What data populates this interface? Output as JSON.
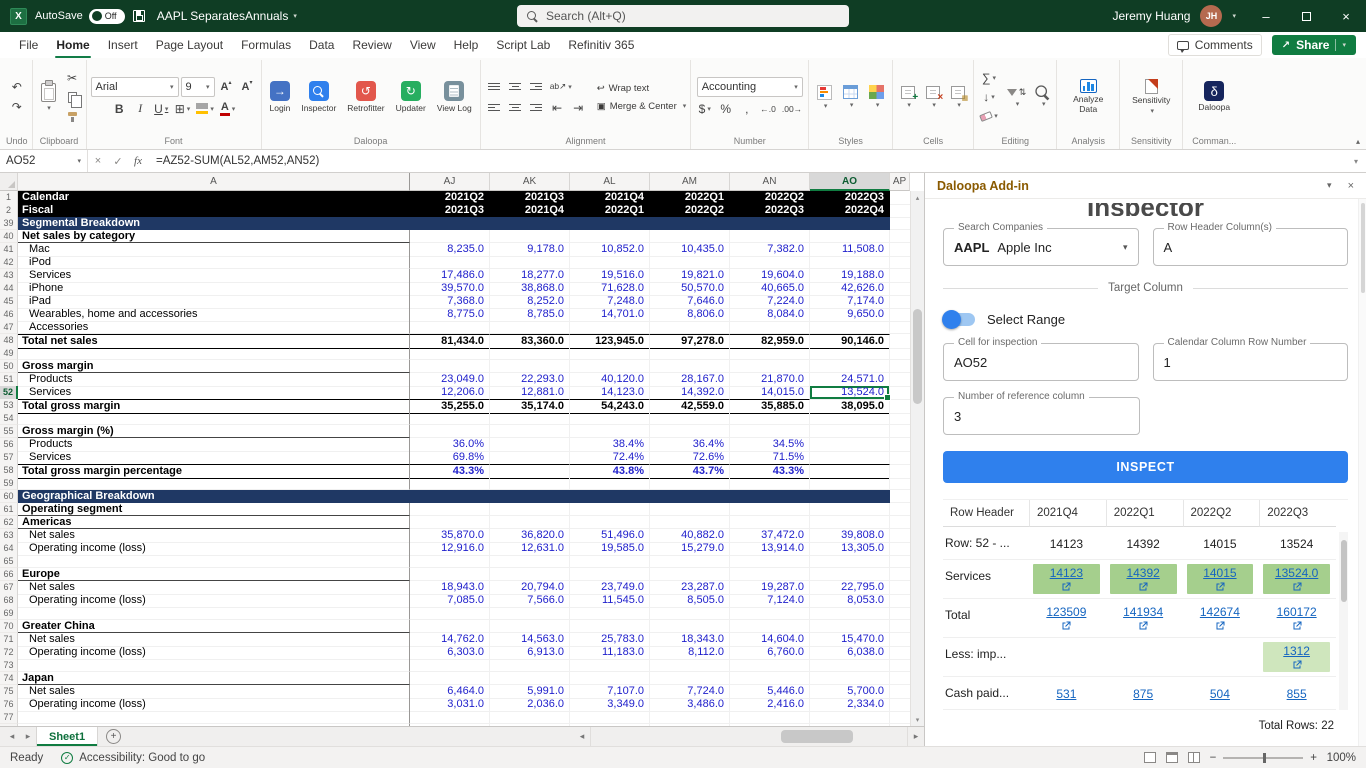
{
  "titlebar": {
    "autosave_label": "AutoSave",
    "autosave_state": "Off",
    "title": "AAPL SeparatesAnnuals",
    "search_placeholder": "Search (Alt+Q)",
    "user_name": "Jeremy Huang",
    "user_initials": "JH"
  },
  "menubar": {
    "tabs": [
      "File",
      "Home",
      "Insert",
      "Page Layout",
      "Formulas",
      "Data",
      "Review",
      "View",
      "Help",
      "Script Lab",
      "Refinitiv 365"
    ],
    "active_tab": "Home",
    "comments_label": "Comments",
    "share_label": "Share"
  },
  "ribbon": {
    "font_name": "Arial",
    "font_size": "9",
    "number_format": "Accounting",
    "wrap_text": "Wrap text",
    "merge_center": "Merge & Center",
    "daloopa_buttons": [
      "Login",
      "Inspector",
      "Retrofitter",
      "Updater",
      "View Log"
    ],
    "analyze_label": "Analyze Data",
    "sensitivity_label": "Sensitivity",
    "daloopa_label": "Daloopa",
    "group_labels": [
      "Undo",
      "Clipboard",
      "Font",
      "Daloopa",
      "Alignment",
      "Number",
      "Styles",
      "Cells",
      "Editing",
      "Analysis",
      "Sensitivity",
      "Comman..."
    ]
  },
  "formula_bar": {
    "name_box": "AO52",
    "formula": "=AZ52-SUM(AL52,AM52,AN52)"
  },
  "sheet": {
    "col_headers": [
      "A",
      "AJ",
      "AK",
      "AL",
      "AM",
      "AN",
      "AO",
      "AP"
    ],
    "selected_col": "AO",
    "selected_row": 52,
    "selected_cell": "AO52",
    "tab_name": "Sheet1",
    "rows": [
      {
        "n": 1,
        "style": "hdr",
        "label": "Calendar",
        "values": [
          "2021Q2",
          "2021Q3",
          "2021Q4",
          "2022Q1",
          "2022Q2",
          "2022Q3"
        ]
      },
      {
        "n": 2,
        "style": "hdr",
        "label": "Fiscal",
        "values": [
          "2021Q3",
          "2021Q4",
          "2022Q1",
          "2022Q2",
          "2022Q3",
          "2022Q4"
        ]
      },
      {
        "n": 39,
        "style": "section",
        "label": "Segmental Breakdown"
      },
      {
        "n": 40,
        "style": "subhead",
        "label": "Net sales by category"
      },
      {
        "n": 41,
        "style": "data",
        "indent": 1,
        "label": "Mac",
        "values": [
          "8,235.0",
          "9,178.0",
          "10,852.0",
          "10,435.0",
          "7,382.0",
          "11,508.0"
        ]
      },
      {
        "n": 42,
        "style": "data",
        "indent": 1,
        "label": "iPod"
      },
      {
        "n": 43,
        "style": "data",
        "indent": 1,
        "label": "Services",
        "values": [
          "17,486.0",
          "18,277.0",
          "19,516.0",
          "19,821.0",
          "19,604.0",
          "19,188.0"
        ]
      },
      {
        "n": 44,
        "style": "data",
        "indent": 1,
        "label": "iPhone",
        "values": [
          "39,570.0",
          "38,868.0",
          "71,628.0",
          "50,570.0",
          "40,665.0",
          "42,626.0"
        ]
      },
      {
        "n": 45,
        "style": "data",
        "indent": 1,
        "label": "iPad",
        "values": [
          "7,368.0",
          "8,252.0",
          "7,248.0",
          "7,646.0",
          "7,224.0",
          "7,174.0"
        ]
      },
      {
        "n": 46,
        "style": "data",
        "indent": 1,
        "label": "Wearables, home and accessories",
        "values": [
          "8,775.0",
          "8,785.0",
          "14,701.0",
          "8,806.0",
          "8,084.0",
          "9,650.0"
        ]
      },
      {
        "n": 47,
        "style": "data",
        "indent": 1,
        "label": "Accessories"
      },
      {
        "n": 48,
        "style": "total",
        "label": "Total net sales",
        "values": [
          "81,434.0",
          "83,360.0",
          "123,945.0",
          "97,278.0",
          "82,959.0",
          "90,146.0"
        ]
      },
      {
        "n": 49,
        "style": "blank"
      },
      {
        "n": 50,
        "style": "subhead",
        "label": "Gross margin"
      },
      {
        "n": 51,
        "style": "data",
        "indent": 1,
        "label": "Products",
        "values": [
          "23,049.0",
          "22,293.0",
          "40,120.0",
          "28,167.0",
          "21,870.0",
          "24,571.0"
        ]
      },
      {
        "n": 52,
        "style": "data",
        "indent": 1,
        "label": "Services",
        "values": [
          "12,206.0",
          "12,881.0",
          "14,123.0",
          "14,392.0",
          "14,015.0",
          "13,524.0"
        ]
      },
      {
        "n": 53,
        "style": "total",
        "label": "Total gross margin",
        "values": [
          "35,255.0",
          "35,174.0",
          "54,243.0",
          "42,559.0",
          "35,885.0",
          "38,095.0"
        ]
      },
      {
        "n": 54,
        "style": "blank"
      },
      {
        "n": 55,
        "style": "subhead",
        "label": "Gross margin (%)"
      },
      {
        "n": 56,
        "style": "pct",
        "indent": 1,
        "label": "Products",
        "values": [
          "36.0%",
          "",
          "38.4%",
          "36.4%",
          "34.5%",
          ""
        ]
      },
      {
        "n": 57,
        "style": "pct",
        "indent": 1,
        "label": "Services",
        "values": [
          "69.8%",
          "",
          "72.4%",
          "72.6%",
          "71.5%",
          ""
        ]
      },
      {
        "n": 58,
        "style": "pcttotal",
        "label": "Total gross margin percentage",
        "values": [
          "43.3%",
          "",
          "43.8%",
          "43.7%",
          "43.3%",
          ""
        ]
      },
      {
        "n": 59,
        "style": "blank"
      },
      {
        "n": 60,
        "style": "section",
        "label": "Geographical Breakdown"
      },
      {
        "n": 61,
        "style": "subhead",
        "label": "Operating segment"
      },
      {
        "n": 62,
        "style": "region",
        "label": "Americas"
      },
      {
        "n": 63,
        "style": "data",
        "indent": 1,
        "label": "Net sales",
        "values": [
          "35,870.0",
          "36,820.0",
          "51,496.0",
          "40,882.0",
          "37,472.0",
          "39,808.0"
        ]
      },
      {
        "n": 64,
        "style": "data",
        "indent": 1,
        "label": "Operating income (loss)",
        "values": [
          "12,916.0",
          "12,631.0",
          "19,585.0",
          "15,279.0",
          "13,914.0",
          "13,305.0"
        ]
      },
      {
        "n": 65,
        "style": "blank"
      },
      {
        "n": 66,
        "style": "region",
        "label": "Europe"
      },
      {
        "n": 67,
        "style": "data",
        "indent": 1,
        "label": "Net sales",
        "values": [
          "18,943.0",
          "20,794.0",
          "23,749.0",
          "23,287.0",
          "19,287.0",
          "22,795.0"
        ]
      },
      {
        "n": 68,
        "style": "data",
        "indent": 1,
        "label": "Operating income (loss)",
        "values": [
          "7,085.0",
          "7,566.0",
          "11,545.0",
          "8,505.0",
          "7,124.0",
          "8,053.0"
        ]
      },
      {
        "n": 69,
        "style": "blank"
      },
      {
        "n": 70,
        "style": "region",
        "label": "Greater China"
      },
      {
        "n": 71,
        "style": "data",
        "indent": 1,
        "label": "Net sales",
        "values": [
          "14,762.0",
          "14,563.0",
          "25,783.0",
          "18,343.0",
          "14,604.0",
          "15,470.0"
        ]
      },
      {
        "n": 72,
        "style": "data",
        "indent": 1,
        "label": "Operating income (loss)",
        "values": [
          "6,303.0",
          "6,913.0",
          "11,183.0",
          "8,112.0",
          "6,760.0",
          "6,038.0"
        ]
      },
      {
        "n": 73,
        "style": "blank"
      },
      {
        "n": 74,
        "style": "region",
        "label": "Japan"
      },
      {
        "n": 75,
        "style": "data",
        "indent": 1,
        "label": "Net sales",
        "values": [
          "6,464.0",
          "5,991.0",
          "7,107.0",
          "7,724.0",
          "5,446.0",
          "5,700.0"
        ]
      },
      {
        "n": 76,
        "style": "data",
        "indent": 1,
        "label": "Operating income (loss)",
        "values": [
          "3,031.0",
          "2,036.0",
          "3,349.0",
          "3,486.0",
          "2,416.0",
          "2,334.0"
        ]
      },
      {
        "n": 77,
        "style": "blank"
      },
      {
        "n": 78,
        "style": "blank"
      }
    ]
  },
  "statusbar": {
    "mode": "Ready",
    "accessibility": "Accessibility: Good to go",
    "zoom": "100%"
  },
  "addin": {
    "header": "Daloopa Add-in",
    "title": "Inspector",
    "search_companies_label": "Search Companies",
    "ticker": "AAPL",
    "company": "Apple Inc",
    "row_header_label": "Row Header Column(s)",
    "row_header_value": "A",
    "target_column_label": "Target Column",
    "select_range_label": "Select Range",
    "cell_label": "Cell for inspection",
    "cell_value": "AO52",
    "calendar_label": "Calendar Column Row Number",
    "calendar_value": "1",
    "ref_label": "Number of reference column",
    "ref_value": "3",
    "inspect_label": "INSPECT",
    "table": {
      "headers": [
        "Row Header",
        "2021Q4",
        "2022Q1",
        "2022Q2",
        "2022Q3"
      ],
      "rows": [
        {
          "label": "Row: 52 - ...",
          "cells": [
            {
              "t": "14123"
            },
            {
              "t": "14392"
            },
            {
              "t": "14015"
            },
            {
              "t": "13524"
            }
          ]
        },
        {
          "label": "Services",
          "cells": [
            {
              "t": "14123",
              "bg": "green",
              "link": true,
              "icon": true
            },
            {
              "t": "14392",
              "bg": "green",
              "link": true,
              "icon": true
            },
            {
              "t": "14015",
              "bg": "green",
              "link": true,
              "icon": true
            },
            {
              "t": "13524.0",
              "bg": "green",
              "link": true,
              "icon": true
            }
          ]
        },
        {
          "label": "Total",
          "cells": [
            {
              "t": "123509",
              "link": true,
              "icon": true
            },
            {
              "t": "141934",
              "link": true,
              "icon": true
            },
            {
              "t": "142674",
              "link": true,
              "icon": true
            },
            {
              "t": "160172",
              "link": true,
              "icon": true
            }
          ]
        },
        {
          "label": "Less: imp...",
          "cells": [
            {},
            {},
            {},
            {
              "t": "1312",
              "bg": "lightgreen",
              "link": true,
              "icon": true
            }
          ]
        },
        {
          "label": "Cash paid...",
          "cells": [
            {
              "t": "531",
              "link": true
            },
            {
              "t": "875",
              "link": true
            },
            {
              "t": "504",
              "link": true
            },
            {
              "t": "855",
              "link": true
            }
          ]
        }
      ],
      "total_rows": "Total Rows: 22"
    }
  },
  "icons": {
    "app": "X",
    "undo": "↶",
    "redo": "↷",
    "cut": "✂",
    "dropdown": "▾",
    "bold": "B",
    "italic": "I",
    "underline": "U",
    "borders": "⊞",
    "letter_A": "A",
    "grow_caret": "▴",
    "shrink_caret": "▾",
    "wrap": "↩",
    "merge": "▣",
    "orient": "ab↗",
    "indent_left": "⇤",
    "indent_right": "⇥",
    "currency": "$",
    "percent": "%",
    "comma": ",",
    "increase_decimal": "←.0",
    "decrease_decimal": ".00→",
    "autosum": "∑",
    "fill_down": "↓",
    "sort_az": "⇅",
    "daloopa_delta": "δ",
    "login_arrow": "→",
    "retrofit_arrow": "↺",
    "update_arrow": "↻",
    "cancel": "×",
    "check": "✓",
    "fx": "fx",
    "min": "–",
    "close": "×",
    "nav_left": "◂",
    "nav_right": "▸",
    "collapse": "▴",
    "plus": "+",
    "panel_collapse": "‹",
    "acc_check": "✓",
    "minus": "−",
    "share_arrow": "↗"
  }
}
